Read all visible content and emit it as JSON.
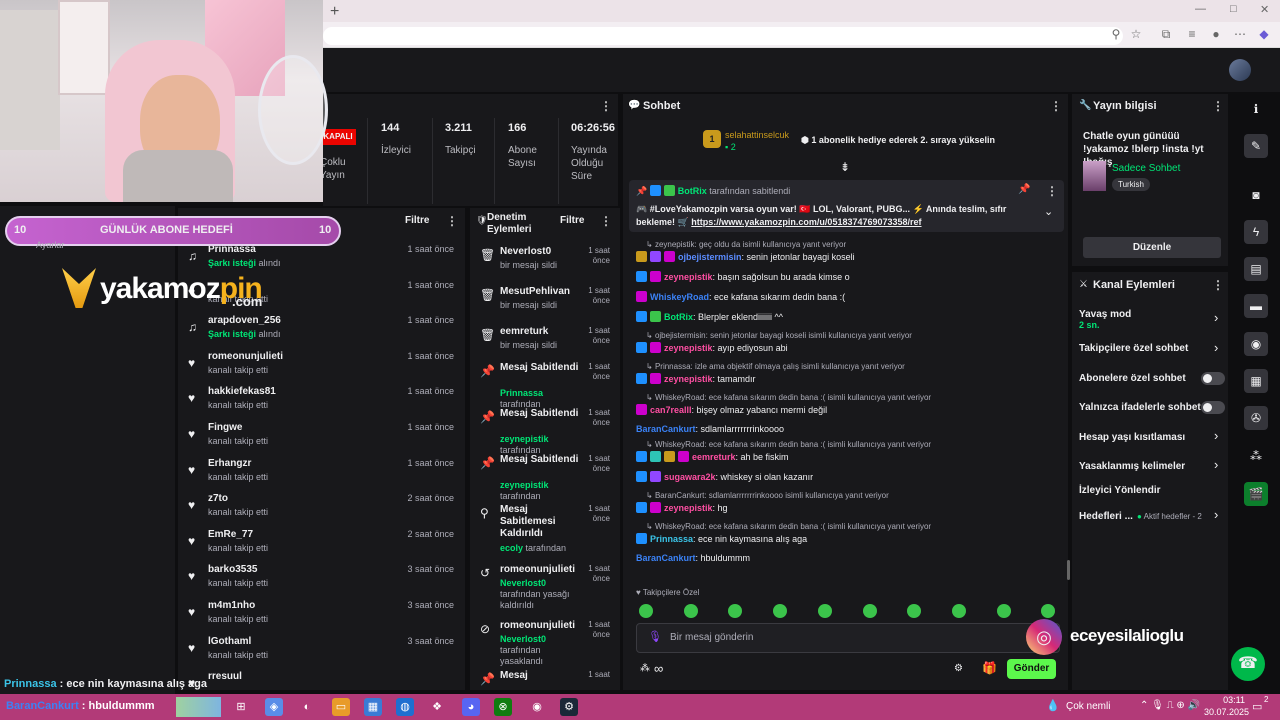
{
  "colors": {
    "accent": "#9147ff",
    "green": "#00e676",
    "send": "#5cf84c",
    "taskbar": "#b23a78"
  },
  "stats": [
    {
      "value": "KAPALI",
      "label": "Çoklu Yayın"
    },
    {
      "value": "144",
      "label": "İzleyici"
    },
    {
      "value": "3.211",
      "label": "Takipçi"
    },
    {
      "value": "166",
      "label": "Abone Sayısı"
    },
    {
      "value": "06:26:56",
      "label": "Yayında Olduğu Süre"
    }
  ],
  "activity": {
    "filter": "Filtre",
    "rows": [
      {
        "name": "Prinnassa",
        "sub_b": "Şarkı isteği",
        "sub": " alındı",
        "time": "1 saat önce",
        "icon": "music-icon"
      },
      {
        "name": "",
        "sub_b": "",
        "sub": "kanalı takip etti",
        "time": "1 saat önce",
        "icon": "heart-icon"
      },
      {
        "name": "arapdoven_256",
        "sub_b": "Şarkı isteği",
        "sub": " alındı",
        "time": "1 saat önce",
        "icon": "music-icon"
      },
      {
        "name": "romeonunjulieti",
        "sub_b": "",
        "sub": "kanalı takip etti",
        "time": "1 saat önce",
        "icon": "heart-icon"
      },
      {
        "name": "hakkiefekas81",
        "sub_b": "",
        "sub": "kanalı takip etti",
        "time": "1 saat önce",
        "icon": "heart-icon"
      },
      {
        "name": "Fingwe",
        "sub_b": "",
        "sub": "kanalı takip etti",
        "time": "1 saat önce",
        "icon": "heart-icon"
      },
      {
        "name": "Erhangzr",
        "sub_b": "",
        "sub": "kanalı takip etti",
        "time": "1 saat önce",
        "icon": "heart-icon"
      },
      {
        "name": "z7to",
        "sub_b": "",
        "sub": "kanalı takip etti",
        "time": "2 saat önce",
        "icon": "heart-icon"
      },
      {
        "name": "EmRe_77",
        "sub_b": "",
        "sub": "kanalı takip etti",
        "time": "2 saat önce",
        "icon": "heart-icon"
      },
      {
        "name": "barko3535",
        "sub_b": "",
        "sub": "kanalı takip etti",
        "time": "3 saat önce",
        "icon": "heart-icon"
      },
      {
        "name": "m4m1nho",
        "sub_b": "",
        "sub": "kanalı takip etti",
        "time": "3 saat önce",
        "icon": "heart-icon"
      },
      {
        "name": "lGothaml",
        "sub_b": "",
        "sub": "kanalı takip etti",
        "time": "3 saat önce",
        "icon": "heart-icon"
      },
      {
        "name": "rresuul",
        "sub_b": "",
        "sub": "",
        "time": "",
        "icon": "heart-icon"
      }
    ]
  },
  "mod": {
    "title": "Denetim Eylemleri",
    "filter": "Filtre",
    "rows": [
      {
        "name": "Neverlost0",
        "user": "",
        "sub": "bir mesajı sildi",
        "time": "1 saat önce",
        "icon": "trash-icon"
      },
      {
        "name": "MesutPehlivan",
        "user": "",
        "sub": "bir mesajı sildi",
        "time": "1 saat önce",
        "icon": "trash-icon"
      },
      {
        "name": "eemreturk",
        "user": "",
        "sub": "bir mesajı sildi",
        "time": "1 saat önce",
        "icon": "trash-icon"
      },
      {
        "name": "Mesaj Sabitlendi",
        "user": "Prinnassa",
        "sub": " tarafından",
        "time": "1 saat önce",
        "icon": "pin-icon"
      },
      {
        "name": "Mesaj Sabitlendi",
        "user": "zeynepistik",
        "sub": " tarafından",
        "time": "1 saat önce",
        "icon": "pin-icon"
      },
      {
        "name": "Mesaj Sabitlendi",
        "user": "zeynepistik",
        "sub": " tarafından",
        "time": "1 saat önce",
        "icon": "pin-icon"
      },
      {
        "name": "Mesaj Sabitlemesi Kaldırıldı",
        "user": "ecoly",
        "sub": " tarafından",
        "time": "1 saat önce",
        "icon": "unpin-icon"
      },
      {
        "name": "romeonunjulieti",
        "user": "Neverlost0",
        "sub": " tarafından yasağı kaldırıldı",
        "time": "1 saat önce",
        "icon": "undo-icon"
      },
      {
        "name": "romeonunjulieti",
        "user": "Neverlost0",
        "sub": " tarafından yasaklandı",
        "time": "1 saat önce",
        "icon": "ban-icon"
      },
      {
        "name": "Mesaj",
        "user": "",
        "sub": "",
        "time": "1 saat",
        "icon": "pin-icon"
      }
    ]
  },
  "chat": {
    "title": "Sohbet",
    "gift_user": "selahattinselcuk",
    "gift_count": "2",
    "gift_level": "1",
    "gift_text": "1 abonelik hediye ederek 2. sıraya yükselin",
    "pinned_by": "BotRix",
    "pinned_suffix": " tarafından sabitlendi",
    "pinned_text": "🎮 #LoveYakamozpin varsa oyun var! 🇹🇷 LOL, Valorant, PUBG... ⚡ Anında teslim, sıfır bekleme! 🛒",
    "pinned_link": "https://www.yakamozpin.com/u/0518374769073358/ref",
    "lines": [
      {
        "kind": "sys",
        "text": "zeynepistik: geç oldu da isimli kullanıcıya yanıt veriyor"
      },
      {
        "kind": "msg",
        "user": "ojbejistermisin",
        "color": "#5b8cff",
        "text": ": senin jetonlar bayagi koseli",
        "badges": [
          "#c99a1c",
          "#9147ff",
          "#c0c"
        ]
      },
      {
        "kind": "msg",
        "user": "zeynepistik",
        "color": "#ff4fa3",
        "text": ": başın sağolsun bu arada kimse o",
        "badges": [
          "#1e90ff",
          "#c0c"
        ]
      },
      {
        "kind": "msg",
        "user": "WhiskeyRoad",
        "color": "#3b82f6",
        "text": ": ece kafana sıkarım dedin bana :(",
        "badges": [
          "#c0c"
        ]
      },
      {
        "kind": "msg",
        "user": "BotRix",
        "color": "#00e676",
        "text": ": Blerpler eklendiiiiiii ^^",
        "badges": [
          "#1e90ff",
          "#3bc44b"
        ]
      },
      {
        "kind": "sys",
        "text": "ojbejistermisin: senin jetonlar bayagi koseli isimli kullanıcıya yanıt veriyor"
      },
      {
        "kind": "msg",
        "user": "zeynepistik",
        "color": "#ff4fa3",
        "text": ": ayıp ediyosun abi",
        "badges": [
          "#1e90ff",
          "#c0c"
        ]
      },
      {
        "kind": "sys",
        "text": "Prinnassa: izle ama objektif olmaya çalış isimli kullanıcıya yanıt veriyor"
      },
      {
        "kind": "msg",
        "user": "zeynepistik",
        "color": "#ff4fa3",
        "text": ": tamamdır",
        "badges": [
          "#1e90ff",
          "#c0c"
        ]
      },
      {
        "kind": "sys",
        "text": "WhiskeyRoad: ece kafana sıkarım dedin bana :( isimli kullanıcıya yanıt veriyor"
      },
      {
        "kind": "msg",
        "user": "can7realll",
        "color": "#ff4fa3",
        "text": ": bişey olmaz yabancı mermi değil",
        "badges": [
          "#c0c"
        ]
      },
      {
        "kind": "msg",
        "user": "BaranCankurt",
        "color": "#3b82f6",
        "text": ": sdlamlarrrrrrrinkoooo",
        "badges": []
      },
      {
        "kind": "sys",
        "text": "WhiskeyRoad: ece kafana sıkarım dedin bana :( isimli kullanıcıya yanıt veriyor"
      },
      {
        "kind": "msg",
        "user": "eemreturk",
        "color": "#ff4fa3",
        "text": ": ah be fiskim",
        "badges": [
          "#1e90ff",
          "#2ec4b6",
          "#c99a1c",
          "#c0c"
        ]
      },
      {
        "kind": "msg",
        "user": "sugawara2k",
        "color": "#ff4fa3",
        "text": ": whiskey si olan kazanır",
        "badges": [
          "#1e90ff",
          "#9147ff"
        ]
      },
      {
        "kind": "sys",
        "text": "BaranCankurt: sdlamlarrrrrrrinkoooo isimli kullanıcıya yanıt veriyor"
      },
      {
        "kind": "msg",
        "user": "zeynepistik",
        "color": "#ff4fa3",
        "text": ": hg",
        "badges": [
          "#1e90ff",
          "#c0c"
        ]
      },
      {
        "kind": "sys",
        "text": "WhiskeyRoad: ece kafana sıkarım dedin bana :( isimli kullanıcıya yanıt veriyor"
      },
      {
        "kind": "msg",
        "user": "Prinnassa",
        "color": "#3bc4e8",
        "text": ": ece nin kaymasına alış aga",
        "badges": [
          "#1e90ff"
        ]
      },
      {
        "kind": "msg",
        "user": "BaranCankurt",
        "color": "#3b82f6",
        "text": ": hbuldummm",
        "badges": []
      }
    ],
    "followers_label": "Takipçilere Özel",
    "input_placeholder": "Bir mesaj gönderin",
    "send": "Gönder",
    "infinity": "∞"
  },
  "stream_info": {
    "title": "Yayın bilgisi",
    "stream_title": "Chatle oyun günüüü !yakamoz !blerp !insta !yt !bağış",
    "category": "Sadece Sohbet",
    "tag": "Turkish",
    "edit": "Düzenle"
  },
  "channel_actions": {
    "title": "Kanal Eylemleri",
    "slow_mode": "Yavaş mod",
    "slow_value": "2 sn.",
    "followers_chat": "Takipçilere özel sohbet",
    "subs_chat": "Abonelere özel sohbet",
    "emote_chat": "Yalnızca ifadelerle sohbet",
    "age": "Hesap yaşı kısıtlaması",
    "banned_words": "Yasaklanmış kelimeler",
    "viewer_redirect": "İzleyici Yönlendir",
    "goals": "Hedefleri ...",
    "goals_value": "Aktif hedefler - 2"
  },
  "overlay": {
    "goal_left": "10",
    "goal_title": "GÜNLÜK ABONE HEDEFİ",
    "goal_right": "10",
    "brand": "yakamoz",
    "brand2": "pin",
    "brand3": ".com",
    "insta": "eceyesilalioglu",
    "ticker1_user": "Prinnassa",
    "ticker1_text": " : ece nin kaymasına alış aga",
    "ticker2_user": "BaranCankurt",
    "ticker2_text": " : hbuldummm",
    "side_label": "Ayarlar"
  },
  "taskbar": {
    "weather": "Çok nemli",
    "time": "03:11",
    "date": "30.07.2025",
    "notif": "2"
  }
}
